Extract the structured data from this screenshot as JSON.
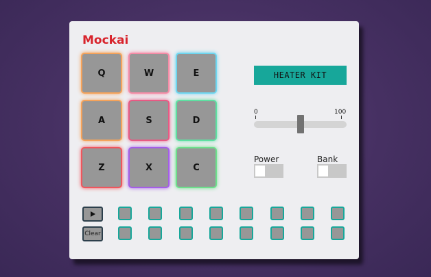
{
  "app": {
    "brand": "Mockai"
  },
  "pads": [
    {
      "key": "Q",
      "color": "#f5a35b"
    },
    {
      "key": "W",
      "color": "#f58ca7"
    },
    {
      "key": "E",
      "color": "#6ed6f0"
    },
    {
      "key": "A",
      "color": "#f5a35b"
    },
    {
      "key": "S",
      "color": "#e85a84"
    },
    {
      "key": "D",
      "color": "#5ee0a2"
    },
    {
      "key": "Z",
      "color": "#f0565d"
    },
    {
      "key": "X",
      "color": "#a55ee8"
    },
    {
      "key": "C",
      "color": "#6de08c"
    }
  ],
  "display": {
    "text": "HEATER KIT"
  },
  "volume": {
    "min_label": "0",
    "max_label": "100",
    "value": 50
  },
  "toggles": {
    "power": {
      "label": "Power",
      "on": false
    },
    "bank": {
      "label": "Bank",
      "on": false
    }
  },
  "sequencer": {
    "play_icon": "play-icon",
    "clear_label": "Clear",
    "steps_per_row": 8,
    "rows": 2
  },
  "colors": {
    "accent": "#17a79a",
    "brand": "#d8232b"
  }
}
